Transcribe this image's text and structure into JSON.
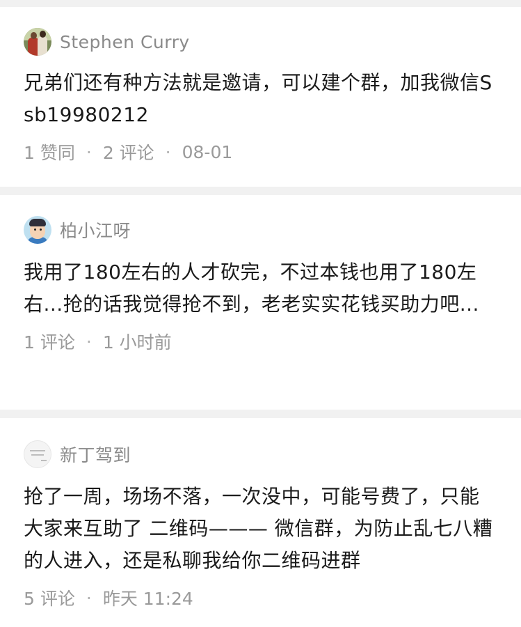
{
  "comments": [
    {
      "author": "Stephen Curry",
      "avatar_icon": "user-photo-avatar",
      "content": "兄弟们还有种方法就是邀请，可以建个群，加我微信Ssb19980212",
      "likes": "1 赞同",
      "comments": "2 评论",
      "time": "08-01"
    },
    {
      "author": "柏小江呀",
      "avatar_icon": "cartoon-avatar",
      "content": "我用了180左右的人才砍完，不过本钱也用了180左右...抢的话我觉得抢不到，老老实实花钱买助力吧...",
      "comments": "1 评论",
      "time": "1 小时前"
    },
    {
      "author": "新丁驾到",
      "avatar_icon": "text-logo-avatar",
      "content": "抢了一周，场场不落，一次没中，可能号费了，只能大家来互助了 二维码——— 微信群，为防止乱七八糟的人进入，还是私聊我给你二维码进群",
      "comments": "5 评论",
      "time": "昨天 11:24"
    }
  ],
  "separator": "·",
  "colors": {
    "page_background": "#f1f1f1",
    "card_background": "#ffffff",
    "author_text": "#8a8a8a",
    "body_text": "#1a1a1a",
    "meta_text": "#9a9a9a"
  }
}
